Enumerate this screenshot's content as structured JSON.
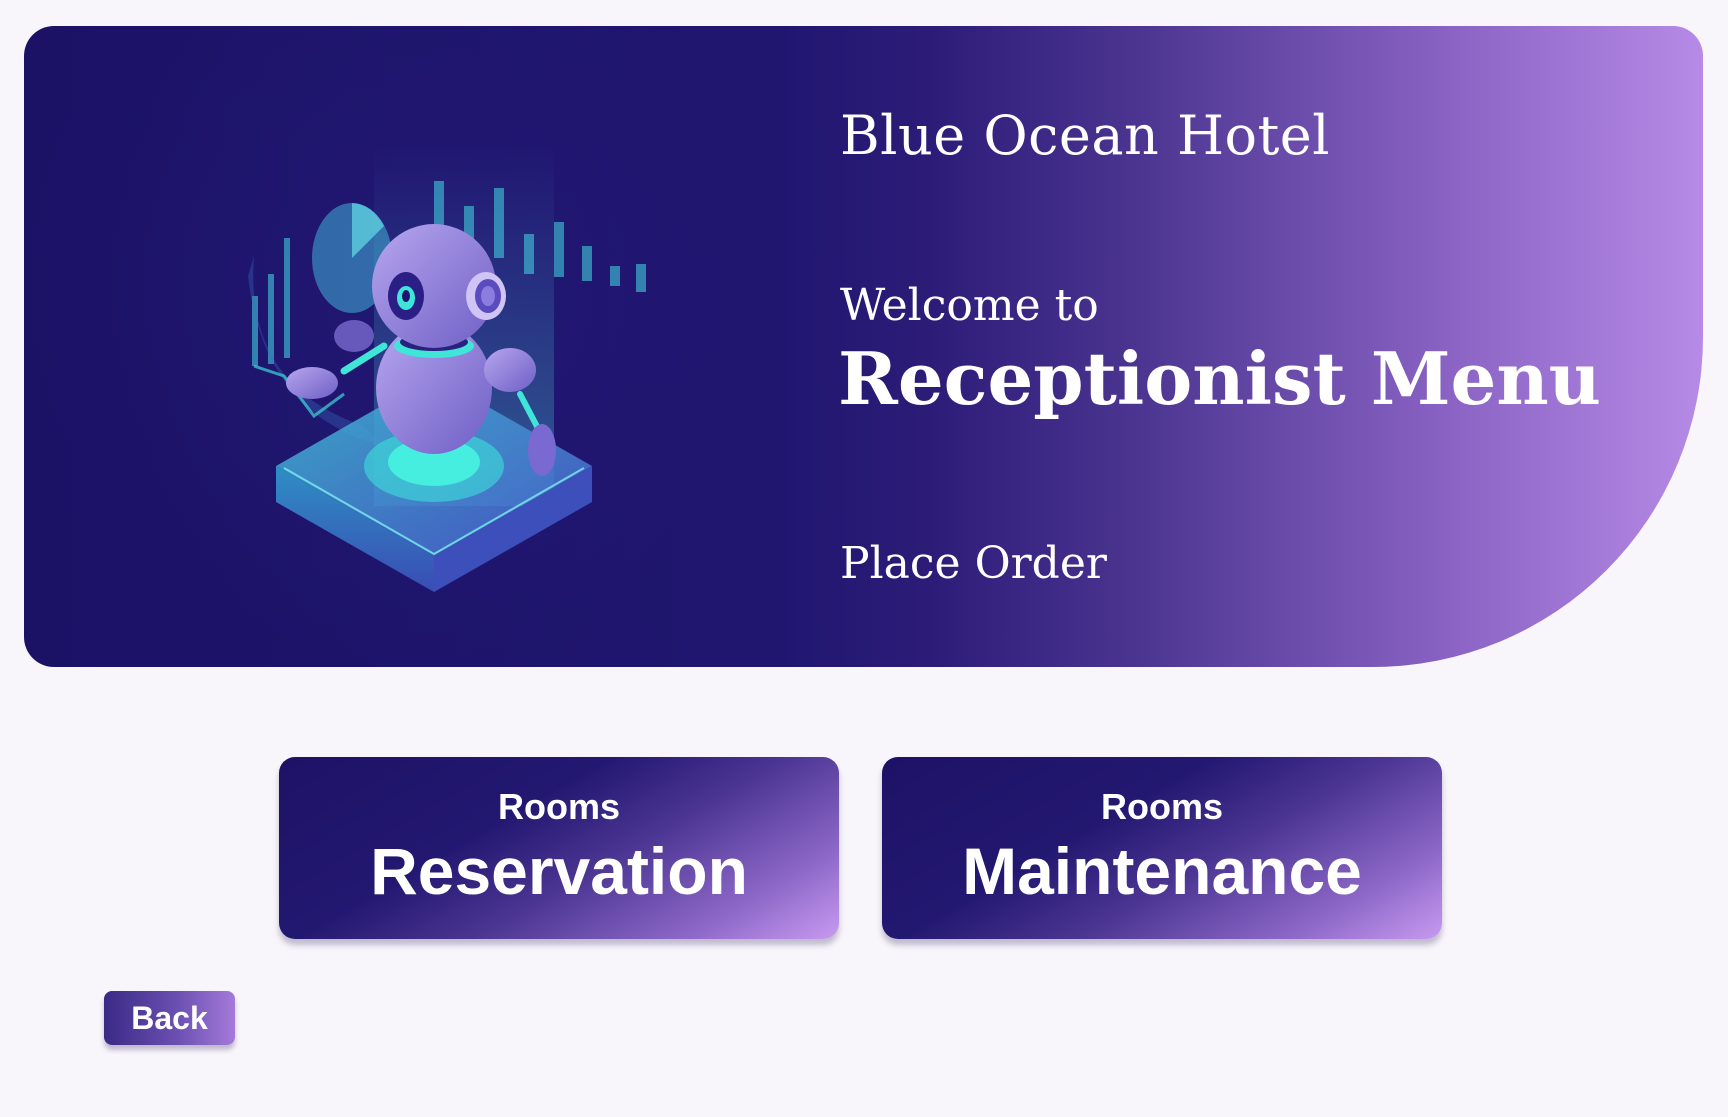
{
  "hero": {
    "hotel_name": "Blue Ocean Hotel",
    "welcome": "Welcome to",
    "title": "Receptionist Menu",
    "place_order": "Place Order",
    "illustration": "robot-assistant-illustration"
  },
  "actions": {
    "reservation": {
      "small": "Rooms",
      "big": "Reservation"
    },
    "maintenance": {
      "small": "Rooms",
      "big": "Maintenance"
    }
  },
  "back_label": "Back",
  "colors": {
    "background": "#f8f5fb",
    "hero_dark": "#1b1266",
    "hero_light": "#b68ae6",
    "accent_teal": "#3fe6d8",
    "robot_purple": "#8a7ad8"
  }
}
